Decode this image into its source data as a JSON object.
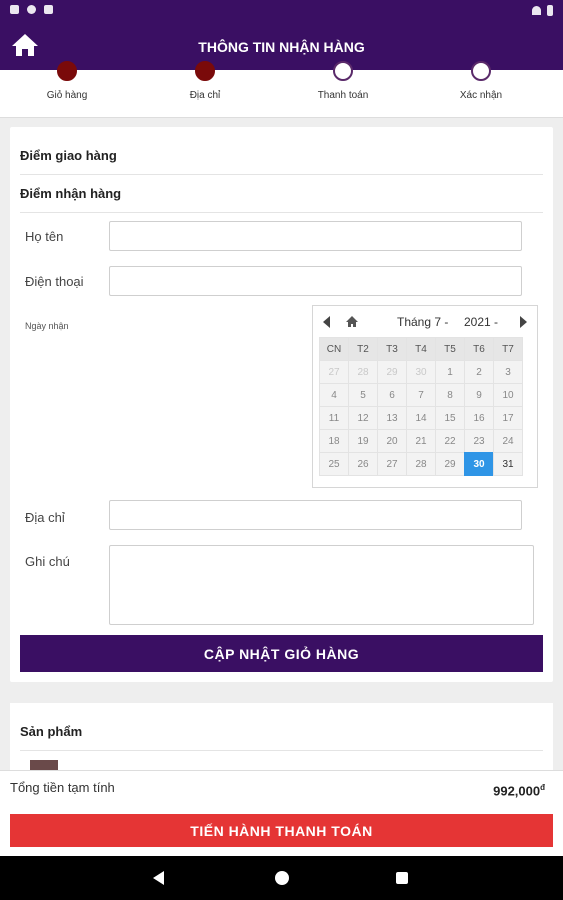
{
  "header": {
    "title": "THÔNG TIN NHẬN HÀNG"
  },
  "steps": [
    {
      "label": "Giỏ hàng",
      "done": true
    },
    {
      "label": "Địa chỉ",
      "done": true
    },
    {
      "label": "Thanh toán",
      "done": false
    },
    {
      "label": "Xác nhận",
      "done": false
    }
  ],
  "form": {
    "delivery_point": "Điểm giao hàng",
    "receive_point": "Điểm nhận hàng",
    "name_label": "Họ tên",
    "name_value": "",
    "phone_label": "Điện thoại",
    "phone_value": "",
    "date_label": "Ngày nhận",
    "address_label": "Địa chỉ",
    "address_value": "",
    "note_label": "Ghi chú",
    "note_value": "",
    "update_button": "CẬP NHẬT GIỎ HÀNG"
  },
  "calendar": {
    "month": "Tháng 7 -",
    "year": "2021 -",
    "weekdays": [
      "CN",
      "T2",
      "T3",
      "T4",
      "T5",
      "T6",
      "T7"
    ],
    "weeks": [
      [
        "27",
        "28",
        "29",
        "30",
        "1",
        "2",
        "3"
      ],
      [
        "4",
        "5",
        "6",
        "7",
        "8",
        "9",
        "10"
      ],
      [
        "11",
        "12",
        "13",
        "14",
        "15",
        "16",
        "17"
      ],
      [
        "18",
        "19",
        "20",
        "21",
        "22",
        "23",
        "24"
      ],
      [
        "25",
        "26",
        "27",
        "28",
        "29",
        "30",
        "31"
      ]
    ],
    "selected": "30"
  },
  "products": {
    "title": "Sản phẩm"
  },
  "footer": {
    "total_label": "Tổng tiền tạm tính",
    "total_value": "992,000",
    "currency": "đ",
    "checkout_button": "TIẾN HÀNH THANH TOÁN"
  },
  "colors": {
    "primary": "#3a0f63",
    "danger": "#e53535",
    "selected_day": "#2f95e6"
  }
}
